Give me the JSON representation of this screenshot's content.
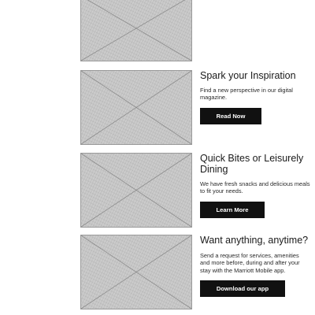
{
  "cards": [
    {
      "image": "placeholder-image"
    },
    {
      "image": "placeholder-image",
      "title": "Spark your Inspiration",
      "description": "Find a new perspective in our digital magazine.",
      "button": "Read Now"
    },
    {
      "image": "placeholder-image",
      "title": "Quick Bites or Leisurely Dining",
      "description": "We have fresh snacks and delicious meals to fit your needs.",
      "button": "Learn More"
    },
    {
      "image": "placeholder-image",
      "title": "Want anything, anytime?",
      "description": "Send a request for services, amenities and more before, during and after your stay with the Marriott Mobile app.",
      "button": "Download our app"
    }
  ],
  "colors": {
    "button_bg": "#111111",
    "button_text": "#ffffff",
    "placeholder": "#c4c4c4"
  }
}
